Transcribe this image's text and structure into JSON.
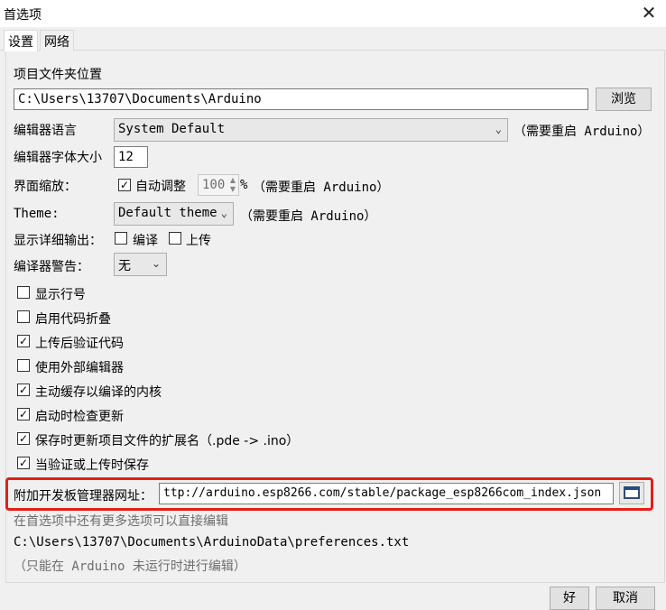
{
  "window": {
    "title": "首选项"
  },
  "tabs": [
    {
      "label": "设置",
      "active": true
    },
    {
      "label": "网络",
      "active": false
    }
  ],
  "sketchbook": {
    "label": "项目文件夹位置",
    "path": "C:\\Users\\13707\\Documents\\Arduino",
    "browse_label": "浏览"
  },
  "language": {
    "label": "编辑器语言",
    "value": "System Default",
    "note": "（需要重启 Arduino）"
  },
  "font_size": {
    "label": "编辑器字体大小",
    "value": "12"
  },
  "scale": {
    "label": "界面缩放：",
    "auto_label": "自动调整",
    "auto_checked": true,
    "value": "100",
    "unit": "%",
    "note": "（需要重启 Arduino）"
  },
  "theme": {
    "label": "Theme:",
    "value": "Default theme",
    "note": "（需要重启 Arduino）"
  },
  "verbose": {
    "label": "显示详细输出：",
    "compile_label": "编译",
    "upload_label": "上传"
  },
  "warnings": {
    "label": "编译器警告：",
    "value": "无"
  },
  "options": [
    {
      "label": "显示行号",
      "checked": false
    },
    {
      "label": "启用代码折叠",
      "checked": false
    },
    {
      "label": "上传后验证代码",
      "checked": true
    },
    {
      "label": "使用外部编辑器",
      "checked": false
    },
    {
      "label": "主动缓存以编译的内核",
      "checked": true
    },
    {
      "label": "启动时检查更新",
      "checked": true
    },
    {
      "label": "保存时更新项目文件的扩展名（.pde -> .ino）",
      "checked": true
    },
    {
      "label": "当验证或上传时保存",
      "checked": true
    }
  ],
  "boards_url": {
    "label": "附加开发板管理器网址：",
    "value": "ttp://arduino.esp8266.com/stable/package_esp8266com_index.json"
  },
  "info": {
    "more_options": "在首选项中还有更多选项可以直接编辑",
    "prefs_path": "C:\\Users\\13707\\Documents\\ArduinoData\\preferences.txt",
    "edit_note": "（只能在 Arduino 未运行时进行编辑）"
  },
  "footer": {
    "ok_label": "好",
    "cancel_label": "取消"
  },
  "icons": {
    "close": "close-icon",
    "checkmark": "checkmark-icon",
    "dropdown": "chevron-down-icon",
    "window": "window-icon"
  },
  "colors": {
    "highlight": "#e0201c"
  }
}
